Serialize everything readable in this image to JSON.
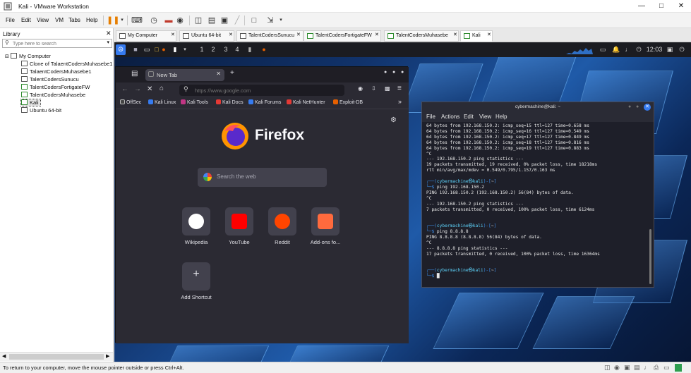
{
  "window": {
    "title": "Kali - VMware Workstation"
  },
  "menubar": {
    "items": [
      "File",
      "Edit",
      "View",
      "VM",
      "Tabs",
      "Help"
    ]
  },
  "library": {
    "header": "Library",
    "search_placeholder": "Type here to search",
    "root": "My Computer",
    "items": [
      "Clone of TalaentCodersMuhasebe1",
      "TalaentCodersMuhasebe1",
      "TalentCodersSunucu",
      "TalentCodersFortigateFW",
      "TalentCodersMuhasebe",
      "Kali",
      "Ubuntu 64-bit"
    ],
    "selected": "Kali"
  },
  "vm_tabs": [
    "My Computer",
    "Ubuntu 64-bit",
    "TalentCodersSunucu",
    "TalentCodersFortigateFW",
    "TalentCodersMuhasebe",
    "Kali"
  ],
  "active_tab": "Kali",
  "guest": {
    "panel": {
      "workspaces": [
        "1",
        "2",
        "3",
        "4"
      ],
      "clock": "12:03"
    },
    "firefox": {
      "tab_title": "New Tab",
      "url_placeholder": "https://www.google.com",
      "bookmarks": [
        "OffSec",
        "Kali Linux",
        "Kali Tools",
        "Kali Docs",
        "Kali Forums",
        "Kali NetHunter",
        "Exploit-DB"
      ],
      "brand": "Firefox",
      "search_placeholder": "Search the web",
      "shortcuts": [
        {
          "label": "Wikipedia",
          "color": "#ffffff"
        },
        {
          "label": "YouTube",
          "color": "#ff0000"
        },
        {
          "label": "Reddit",
          "color": "#ff4500"
        },
        {
          "label": "Add-ons fo...",
          "color": "#ff6a3d"
        }
      ],
      "add_shortcut_label": "Add Shortcut"
    },
    "terminal": {
      "title": "cybermachine@kali: ~",
      "menu": [
        "File",
        "Actions",
        "Edit",
        "View",
        "Help"
      ],
      "lines": [
        "64 bytes from 192.168.150.2: icmp_seq=15 ttl=127 time=0.658 ms",
        "64 bytes from 192.168.150.2: icmp_seq=16 ttl=127 time=0.549 ms",
        "64 bytes from 192.168.150.2: icmp_seq=17 ttl=127 time=0.849 ms",
        "64 bytes from 192.168.150.2: icmp_seq=18 ttl=127 time=0.816 ms",
        "64 bytes from 192.168.150.2: icmp_seq=19 ttl=127 time=0.883 ms",
        "^C",
        "--- 192.168.150.2 ping statistics ---",
        "19 packets transmitted, 19 received, 0% packet loss, time 18218ms",
        "rtt min/avg/max/mdev = 0.549/0.795/1.157/0.163 ms",
        "",
        "┌──(cybermachine㉿kali)-[~]",
        "└─$ ping 192.168.150.2",
        "PING 192.168.150.2 (192.168.150.2) 56(84) bytes of data.",
        "^C",
        "--- 192.168.150.2 ping statistics ---",
        "7 packets transmitted, 0 received, 100% packet loss, time 6124ms",
        "",
        "",
        "┌──(cybermachine㉿kali)-[~]",
        "└─$ ping 8.8.8.8",
        "PING 8.8.8.8 (8.8.8.8) 56(84) bytes of data.",
        "^C",
        "--- 8.8.8.8 ping statistics ---",
        "17 packets transmitted, 0 received, 100% packet loss, time 16364ms",
        "",
        "",
        "┌──(cybermachine㉿kali)-[~]",
        "└─$ "
      ]
    }
  },
  "statusbar": {
    "message": "To return to your computer, move the mouse pointer outside or press Ctrl+Alt."
  }
}
